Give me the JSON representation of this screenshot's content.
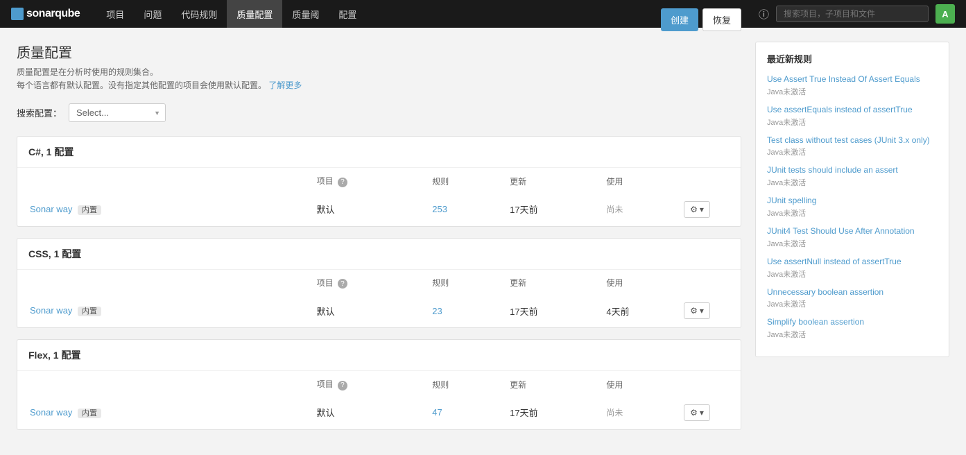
{
  "nav": {
    "logo_text": "sonarqube",
    "items": [
      {
        "label": "项目",
        "active": false
      },
      {
        "label": "问题",
        "active": false
      },
      {
        "label": "代码规则",
        "active": false
      },
      {
        "label": "质量配置",
        "active": true
      },
      {
        "label": "质量阈",
        "active": false
      },
      {
        "label": "配置",
        "active": false
      }
    ],
    "search_placeholder": "搜索项目，子项目和文件",
    "avatar_letter": "A"
  },
  "page": {
    "title": "质量配置",
    "desc1": "质量配置是在分析时使用的规则集合。",
    "desc2": "每个语言都有默认配置。没有指定其他配置的项目会使用默认配置。",
    "learn_more": "了解更多",
    "btn_create": "创建",
    "btn_restore": "恢复"
  },
  "filter": {
    "label": "搜索配置：",
    "placeholder": "Select..."
  },
  "sections": [
    {
      "id": "csharp",
      "title": "C#, 1 配置",
      "cols": {
        "project": "项目",
        "rules": "规则",
        "update": "更新",
        "use": "使用"
      },
      "rows": [
        {
          "name": "Sonar way",
          "builtin": "内置",
          "project": "默认",
          "rules": "253",
          "update": "17天前",
          "use": "尚未"
        }
      ]
    },
    {
      "id": "css",
      "title": "CSS, 1 配置",
      "cols": {
        "project": "项目",
        "rules": "规则",
        "update": "更新",
        "use": "使用"
      },
      "rows": [
        {
          "name": "Sonar way",
          "builtin": "内置",
          "project": "默认",
          "rules": "23",
          "update": "17天前",
          "use": "4天前"
        }
      ]
    },
    {
      "id": "flex",
      "title": "Flex, 1 配置",
      "cols": {
        "project": "项目",
        "rules": "规则",
        "update": "更新",
        "use": "使用"
      },
      "rows": [
        {
          "name": "Sonar way",
          "builtin": "内置",
          "project": "默认",
          "rules": "47",
          "update": "17天前",
          "use": "尚未"
        }
      ]
    }
  ],
  "sidebar": {
    "title": "最近新规则",
    "rules": [
      {
        "link": "Use Assert True Instead Of Assert Equals",
        "sub": "Java未激活"
      },
      {
        "link": "Use assertEquals instead of assertTrue",
        "sub": "Java未激活"
      },
      {
        "link": "Test class without test cases (JUnit 3.x only)",
        "sub": "Java未激活"
      },
      {
        "link": "JUnit tests should include an assert",
        "sub": "Java未激活"
      },
      {
        "link": "JUnit spelling",
        "sub": "Java未激活"
      },
      {
        "link": "JUnit4 Test Should Use After Annotation",
        "sub": "Java未激活"
      },
      {
        "link": "Use assertNull instead of assertTrue",
        "sub": "Java未激活"
      },
      {
        "link": "Unnecessary boolean assertion",
        "sub": "Java未激活"
      },
      {
        "link": "Simplify boolean assertion",
        "sub": "Java未激活"
      }
    ]
  },
  "icons": {
    "gear": "⚙",
    "chevron": "▾",
    "question": "?",
    "help_circle": "?"
  }
}
